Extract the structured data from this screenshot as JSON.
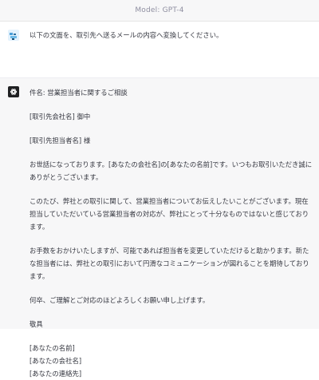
{
  "header": {
    "model_label": "Model: GPT-4"
  },
  "user_message": {
    "lines": [
      "以下の文面を、取引先へ送るメールの内容へ変換してください。",
      ""
    ]
  },
  "assistant_message": {
    "subject": "件名: 営業担当者に関するご相談",
    "recipient_company": "[取引先会社名] 御中",
    "recipient_name": "[取引先担当者名] 様",
    "para1": "お世話になっております。[あなたの会社名]の[あなたの名前]です。いつもお取引いただき誠にありがとうございます。",
    "para2": "このたび、弊社との取引に関して、営業担当者についてお伝えしたいことがございます。現在担当していただいている営業担当者の対応が、弊社にとって十分なものではないと感じております。",
    "para3": "お手数をおかけいたしますが、可能であれば担当者を変更していただけると助かります。新たな担当者には、弊社との取引において円滑なコミュニケーションが図れることを期待しております。",
    "para4": "何卒、ご理解とご対応のほどよろしくお願い申し上げます。",
    "closing": "敬具",
    "sig_name": "[あなたの名前]",
    "sig_company": "[あなたの会社名]",
    "sig_contact": "[あなたの連絡先]"
  }
}
